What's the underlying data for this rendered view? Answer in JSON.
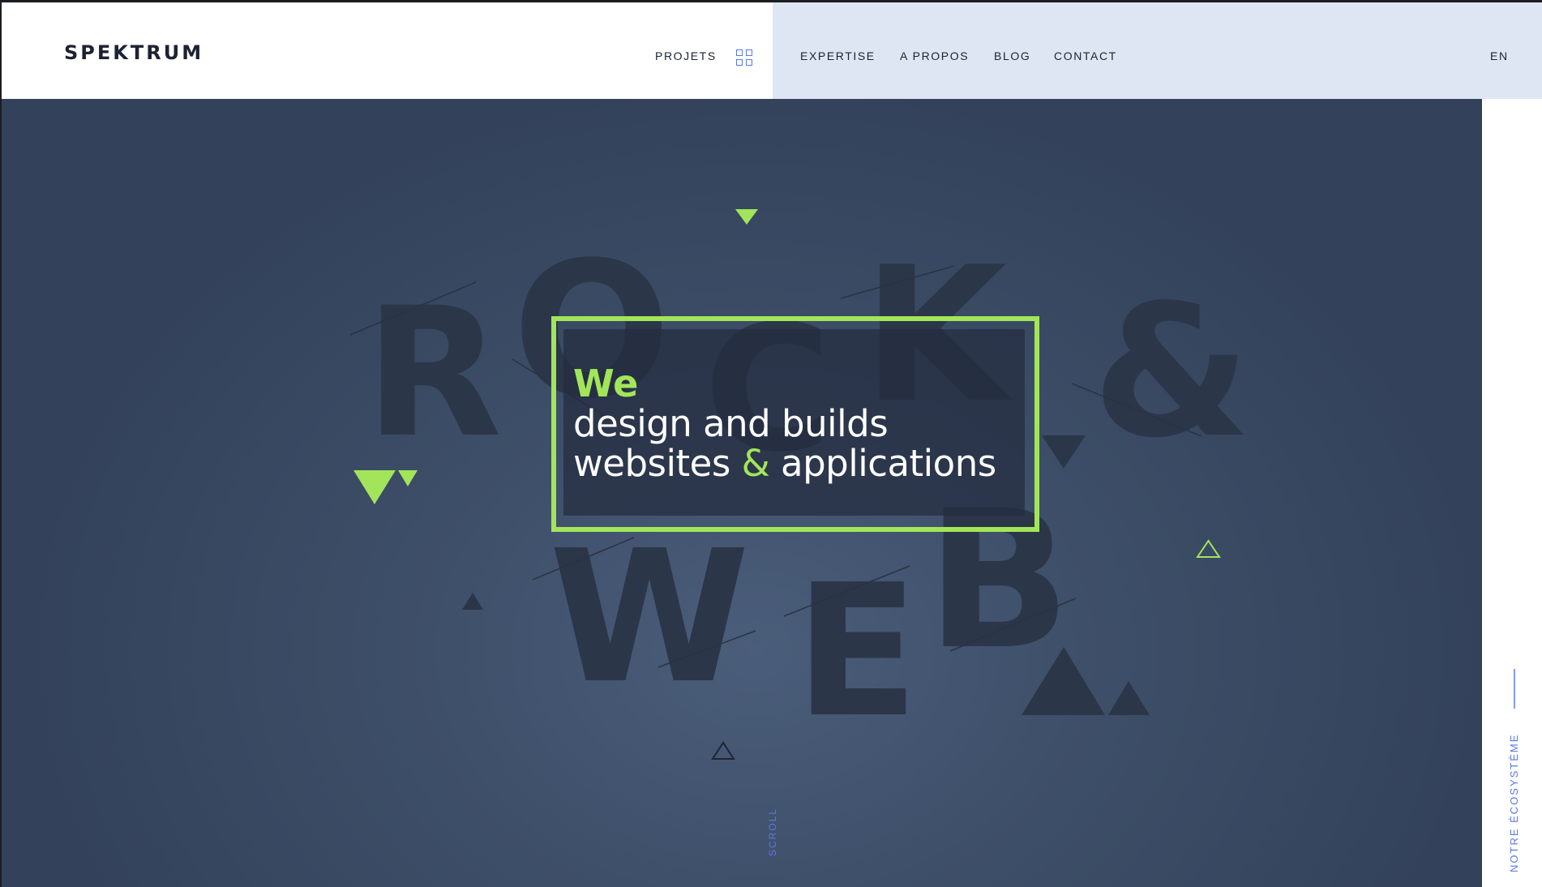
{
  "header": {
    "logo": "SPEKTRUM",
    "nav": {
      "projets": "PROJETS",
      "expertise": "EXPERTISE",
      "a_propos": "A PROPOS",
      "blog": "BLOG",
      "contact": "CONTACT"
    },
    "language": "EN"
  },
  "hero": {
    "letters": {
      "r": "R",
      "o": "O",
      "c": "C",
      "k": "K",
      "amp": "&",
      "w": "W",
      "e": "E",
      "b": "B"
    },
    "tagline": {
      "we": "We",
      "line1": "design and builds",
      "line2_a": "websites ",
      "line2_amp": "&",
      "line2_b": " applications"
    },
    "scroll": "SCROLL"
  },
  "sidebar": {
    "ecosystem": "NOTRE ÉCOSYSTÈME"
  },
  "colors": {
    "accent": "#a3e55a",
    "link": "#5a78e6",
    "hero_bg": "#3e4f69",
    "letters": "#2c3649",
    "header_blue": "#dde6f2"
  }
}
